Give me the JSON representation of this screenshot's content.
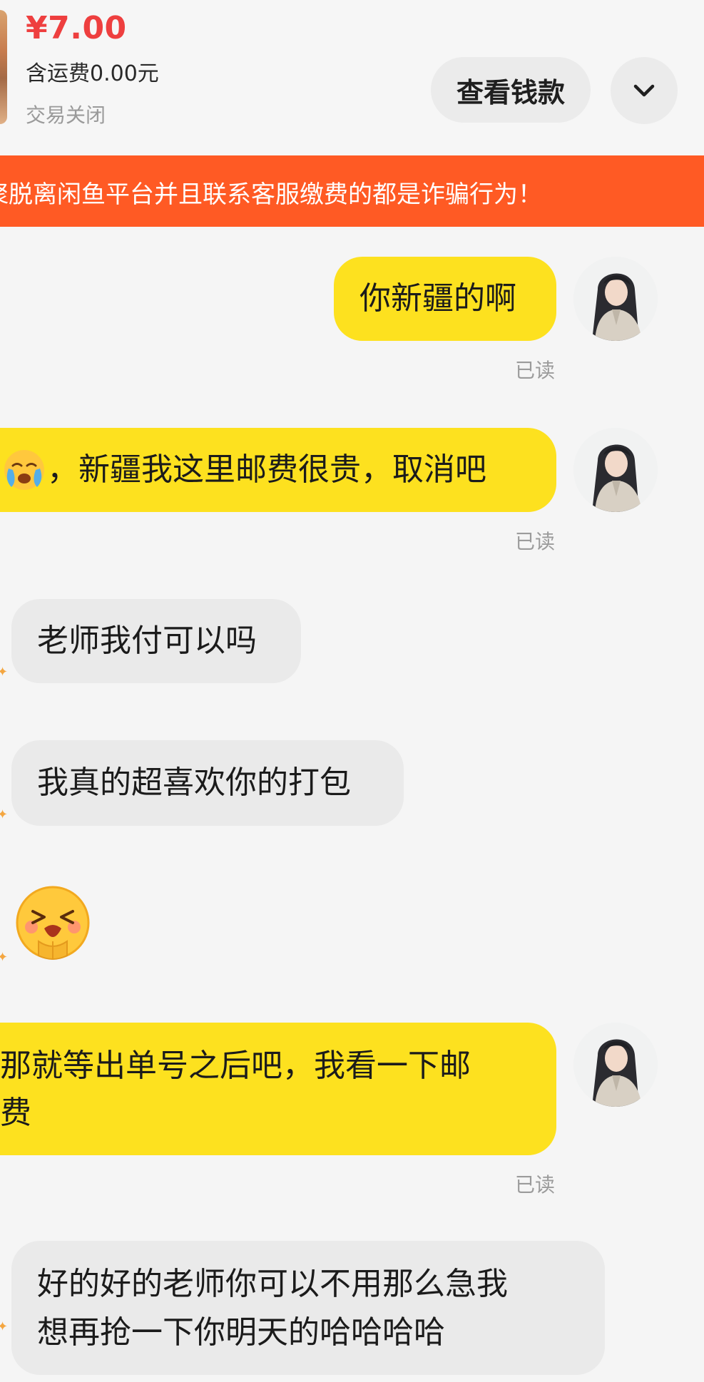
{
  "order": {
    "price": "¥7.00",
    "shipping": "含运费0.00元",
    "status": "交易关闭",
    "view_button": "查看钱款"
  },
  "banner": {
    "text": "聚脱离闲鱼平台并且联系客服缴费的都是诈骗行为！"
  },
  "messages": [
    {
      "sender": "me",
      "text": "你新疆的啊",
      "read": "已读"
    },
    {
      "sender": "me",
      "text": "，新疆我这里邮费很贵，取消吧",
      "read": "已读"
    },
    {
      "sender": "them",
      "text": "老师我付可以吗"
    },
    {
      "sender": "them",
      "text": "我真的超喜欢你的打包"
    },
    {
      "sender": "them",
      "sticker": "pleading-emoji"
    },
    {
      "sender": "me",
      "text_line1": "那就等出单号之后吧，我看一下邮",
      "text_line2": "费",
      "read": "已读"
    },
    {
      "sender": "them",
      "text_line1": "好的好的老师你可以不用那么急我",
      "text_line2": "想再抢一下你明天的哈哈哈哈"
    }
  ],
  "icons": {
    "more": "chevron-down-icon",
    "crying": "crying-emoji",
    "sticker": "pleading-emoji",
    "avatar": "avatar-portrait"
  },
  "colors": {
    "price": "#ee3f3f",
    "banner": "#ff5a24",
    "my_bubble": "#fde11f",
    "their_bubble": "#eaeaea"
  }
}
